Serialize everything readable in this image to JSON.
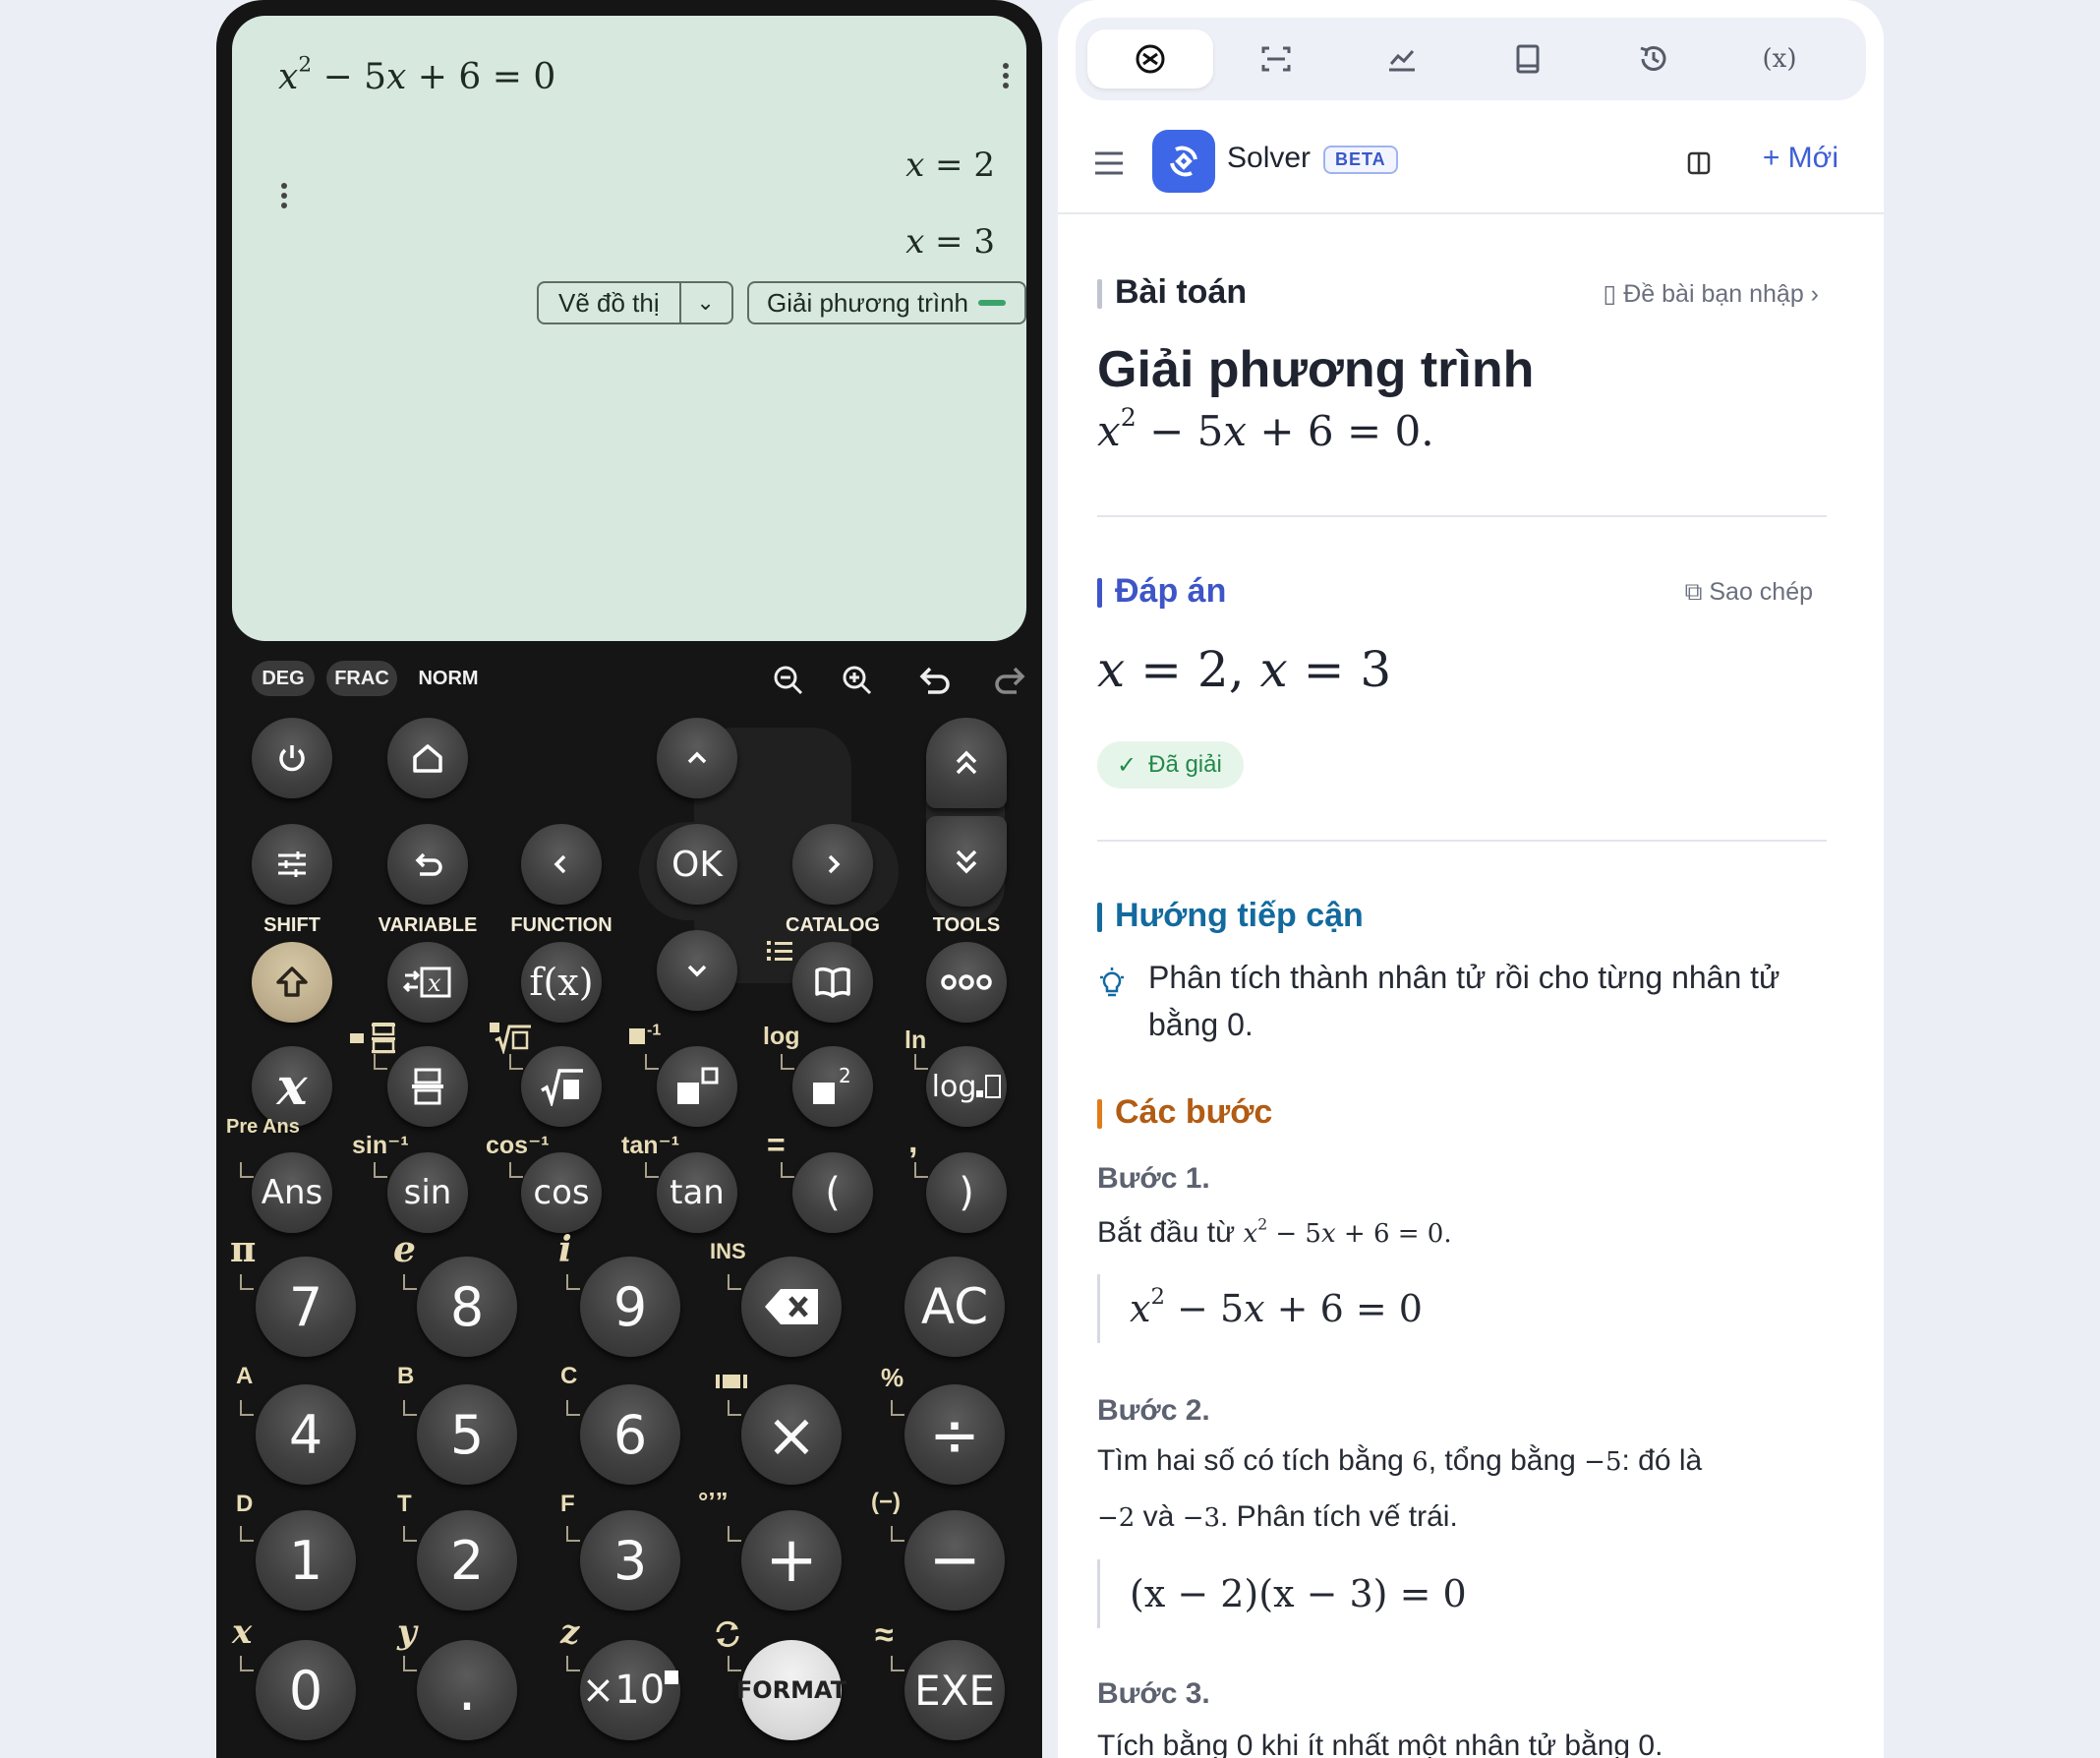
{
  "calculator": {
    "screen": {
      "equation": {
        "x": "x",
        "sup": "2",
        "rest": " − 5",
        "x2": "x",
        "tail": " + 6 = 0"
      },
      "results": [
        {
          "var": "x",
          "val": " = 2"
        },
        {
          "var": "x",
          "val": " = 3"
        }
      ],
      "buttons": {
        "graph": "Vẽ đồ thị",
        "solve": "Giải phương trình"
      }
    },
    "modes": {
      "deg": "DEG",
      "frac": "FRAC",
      "norm": "NORM"
    },
    "function_labels": {
      "shift": "SHIFT",
      "variable": "VARIABLE",
      "function": "FUNCTION",
      "catalog": "CATALOG",
      "tools": "TOOLS"
    },
    "keys": {
      "ok": "OK",
      "fx": "f(x)",
      "x": "x",
      "log_key": "log",
      "ans": "Ans",
      "sin": "sin",
      "cos": "cos",
      "tan": "tan",
      "lparen": "(",
      "rparen": ")",
      "d7": "7",
      "d8": "8",
      "d9": "9",
      "ac": "AC",
      "d4": "4",
      "d5": "5",
      "d6": "6",
      "times": "×",
      "divide": "÷",
      "d1": "1",
      "d2": "2",
      "d3": "3",
      "plus": "+",
      "minus": "−",
      "d0": "0",
      "dot": ".",
      "x10": "×10",
      "format": "FORMAT",
      "exe": "EXE"
    },
    "shifted": {
      "pre_ans": "Pre Ans",
      "sin_inv": "sin⁻¹",
      "cos_inv": "cos⁻¹",
      "tan_inv": "tan⁻¹",
      "equals": "=",
      "comma": ",",
      "pi": "π",
      "e": "e",
      "i": "i",
      "ins": "INS",
      "A": "A",
      "B": "B",
      "C": "C",
      "pct": "%",
      "D": "D",
      "T": "T",
      "F": "F",
      "dms": "°’”",
      "neg": "(−)",
      "x": "x",
      "y": "y",
      "z": "z",
      "approx": "≈",
      "log": "log",
      "ln": "ln",
      "inv": "-1"
    }
  },
  "solver": {
    "app_name": "Solver",
    "beta": "BETA",
    "new_button": "+ Mới",
    "tabs": [
      "solver-icon",
      "scan-icon",
      "graph-icon",
      "notebook-icon",
      "history-icon",
      "(x)"
    ],
    "problem": {
      "heading": "Bài toán",
      "link": "Đề bài bạn nhập",
      "title": "Giải phương trình",
      "expr": {
        "x": "x",
        "sup": "2",
        "rest": " − 5",
        "x2": "x",
        "tail": " + 6 = 0."
      }
    },
    "answer": {
      "heading": "Đáp án",
      "copy": "Sao chép",
      "value": {
        "x1": "x",
        "v1": " = 2, ",
        "x2": "x",
        "v2": " = 3"
      },
      "status": "Đã giải"
    },
    "approach": {
      "heading": "Hướng tiếp cận",
      "text": "Phân tích thành nhân tử rồi cho từng nhân tử bằng 0."
    },
    "steps": {
      "heading": "Các bước",
      "step1": {
        "title": "Bước 1.",
        "text_pre": "Bắt đầu từ ",
        "inline": {
          "x": "x",
          "sup": "2",
          "rest": " − 5",
          "x2": "x",
          "tail": " + 6 = 0."
        },
        "block": {
          "x": "x",
          "sup": "2",
          "rest": " − 5",
          "x2": "x",
          "tail": " + 6 = 0"
        }
      },
      "step2": {
        "title": "Bước 2.",
        "line1_pre": "Tìm hai số có tích bằng ",
        "line1_prod": "6",
        "line1_mid": ", tổng bằng ",
        "line1_sum": "−5",
        "line1_post": ": đó là",
        "line2_a": "−2",
        "line2_mid": " và ",
        "line2_b": "−3",
        "line2_post": ". Phân tích vế trái.",
        "block": "(x − 2)(x − 3) = 0"
      },
      "step3": {
        "title": "Bước 3.",
        "text": "Tích bằng 0 khi ít nhất một nhân tử bằng 0."
      }
    }
  }
}
